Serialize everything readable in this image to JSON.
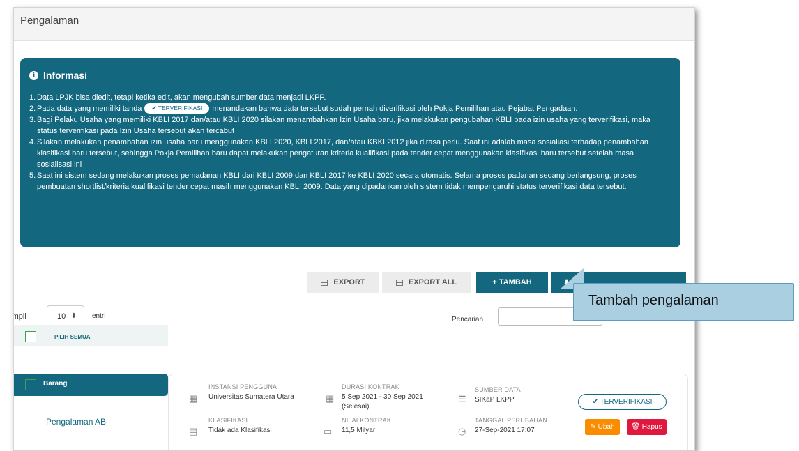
{
  "page": {
    "title": "Pengalaman"
  },
  "info": {
    "title": "Informasi",
    "items": [
      {
        "num": "1.",
        "text": "Data LPJK bisa diedit, tetapi ketika edit, akan mengubah sumber data menjadi LKPP."
      },
      {
        "num": "2.",
        "text_before": "Pada data yang memiliki tanda",
        "badge": "✔ TERVERIFIKASI",
        "text_after": "menandakan bahwa data tersebut sudah pernah diverifikasi oleh Pokja Pemilihan atau Pejabat Pengadaan."
      },
      {
        "num": "3.",
        "text": "Bagi Pelaku Usaha yang memiliki KBLI 2017 dan/atau KBLI 2020 silakan menambahkan Izin Usaha baru, jika melakukan pengubahan KBLI pada izin usaha yang terverifikasi, maka status terverifikasi pada Izin Usaha tersebut akan tercabut"
      },
      {
        "num": "4.",
        "text": "Silakan melakukan penambahan izin usaha baru menggunakan KBLI 2020, KBLI 2017, dan/atau KBKI 2012 jika dirasa perlu. Saat ini adalah masa sosialiasi terhadap penambahan klasifikasi baru tersebut, sehingga Pokja Pemilihan baru dapat melakukan pengaturan kriteria kualifikasi pada tender cepat menggunakan klasifikasi baru tersebut setelah masa sosialisasi ini"
      },
      {
        "num": "5.",
        "text": "Saat ini sistem sedang melakukan proses pemadanan KBLI dari KBLI 2009 dan KBLI 2017 ke KBLI 2020 secara otomatis. Selama proses padanan sedang berlangsung, proses pembuatan shortlist/kriteria kualifikasi tender cepat masih menggunakan KBLI 2009. Data yang dipadankan oleh sistem tidak mempengaruhi status terverifikasi data tersebut."
      }
    ]
  },
  "toolbar": {
    "export": "EXPORT",
    "export_all": "EXPORT ALL",
    "tambah": "+ TAMBAH",
    "import_icon": "⬇"
  },
  "table_controls": {
    "show_label": "Tampil",
    "page_size": "10",
    "entries_label": "entri",
    "search_label": "Pencarian"
  },
  "select_all": {
    "label": "PILIH SEMUA"
  },
  "category": {
    "label": "Barang"
  },
  "experience": {
    "name": "Pengalaman AB",
    "instansi_label": "INSTANSI PENGGUNA",
    "instansi_value": "Universitas Sumatera Utara",
    "klasifikasi_label": "KLASIFIKASI",
    "klasifikasi_value": "Tidak ada Klasifikasi",
    "durasi_label": "DURASI KONTRAK",
    "durasi_value": "5 Sep 2021 - 30 Sep 2021 (Selesai)",
    "nilai_label": "NILAI KONTRAK",
    "nilai_value": "11,5 Milyar",
    "sumber_label": "SUMBER DATA",
    "sumber_value": "SIKaP LKPP",
    "tanggal_label": "TANGGAL PERUBAHAN",
    "tanggal_value": "27-Sep-2021 17:07",
    "badge": "✔ TERVERIFIKASI",
    "ubah": "✎ Ubah",
    "hapus": "🗑 Hapus"
  },
  "callout": {
    "text": "Tambah pengalaman"
  },
  "colors": {
    "primary": "#13677e",
    "ubah": "#fb8c00",
    "hapus": "#e0183d",
    "callout_bg": "#a9cfe0"
  }
}
